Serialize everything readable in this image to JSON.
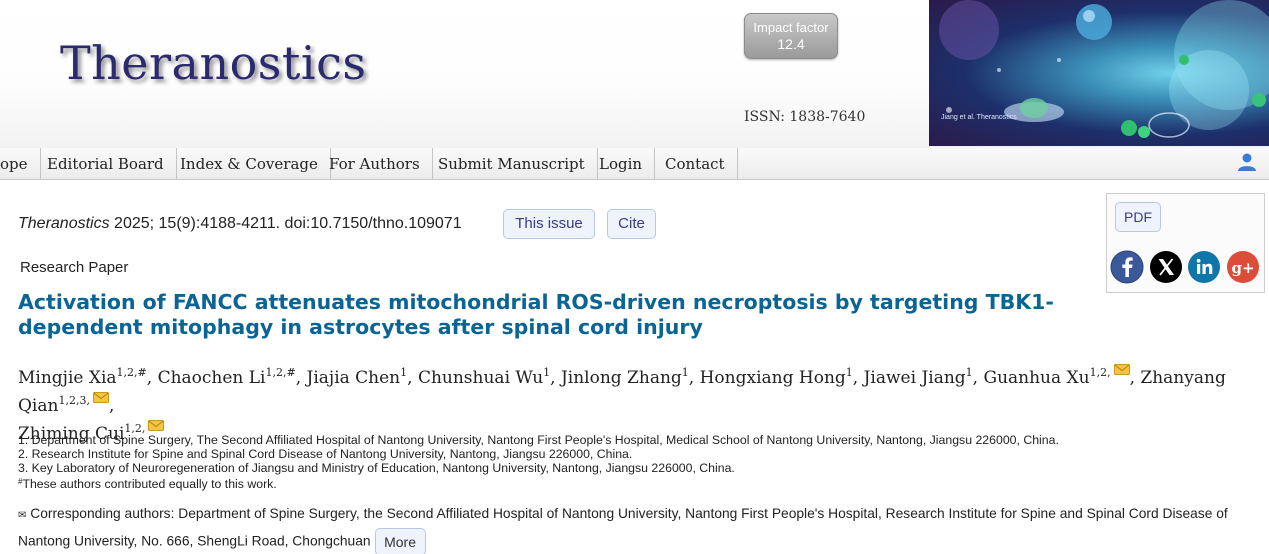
{
  "header": {
    "logo": "Theranostics",
    "impact_factor": {
      "label": "Impact factor",
      "value": "12.4"
    },
    "issn": "ISSN: 1838-7640",
    "cover_credit": "Jiang et al. Theranostics"
  },
  "nav": {
    "items": [
      "ope",
      "Editorial Board",
      "Index & Coverage",
      "For Authors",
      "Submit Manuscript",
      "Login",
      "Contact"
    ]
  },
  "citation": {
    "journal": "Theranostics",
    "details": " 2025; 15(9):4188-4211. doi:10.7150/thno.109071",
    "this_issue": "This issue",
    "cite": "Cite"
  },
  "sidebar": {
    "pdf": "PDF",
    "social": [
      "facebook",
      "x",
      "linkedin",
      "google-plus"
    ]
  },
  "article": {
    "type": "Research Paper",
    "title_line1": "Activation of FANCC attenuates mitochondrial ROS-driven necroptosis by targeting TBK1-",
    "title_line2": "dependent mitophagy in astrocytes after spinal cord injury",
    "authors": [
      {
        "name": "Mingjie Xia",
        "sup": "1,2,#",
        "corresponding": false
      },
      {
        "name": "Chaochen Li",
        "sup": "1,2,#",
        "corresponding": false
      },
      {
        "name": "Jiajia Chen",
        "sup": "1",
        "corresponding": false
      },
      {
        "name": "Chunshuai Wu",
        "sup": "1",
        "corresponding": false
      },
      {
        "name": "Jinlong Zhang",
        "sup": "1",
        "corresponding": false
      },
      {
        "name": "Hongxiang Hong",
        "sup": "1",
        "corresponding": false
      },
      {
        "name": "Jiawei Jiang",
        "sup": "1",
        "corresponding": false
      },
      {
        "name": "Guanhua Xu",
        "sup": "1,2,",
        "corresponding": true
      },
      {
        "name": "Zhanyang Qian",
        "sup": "1,2,3,",
        "corresponding": true
      },
      {
        "name": "Zhiming Cui",
        "sup": "1,2,",
        "corresponding": true
      }
    ],
    "affiliations": [
      "1. Department of Spine Surgery, The Second Affiliated Hospital of Nantong University, Nantong First People's Hospital, Medical School of Nantong University, Nantong, Jiangsu 226000, China.",
      "2. Research Institute for Spine and Spinal Cord Disease of Nantong University, Nantong, Jiangsu 226000, China.",
      "3. Key Laboratory of Neuroregeneration of Jiangsu and Ministry of Education, Nantong University, Nantong, Jiangsu 226000, China."
    ],
    "equal_contrib_mark": "#",
    "equal_contrib": "These authors contributed equally to this work.",
    "corresponding_icon": "✉",
    "corresponding_text": " Corresponding authors: Department of Spine Surgery, the Second Affiliated Hospital of Nantong University, Nantong First People's Hospital, Research Institute for Spine and Spinal Cord Disease of Nantong University, No. 666, ShengLi Road, Chongchuan",
    "more": "More"
  },
  "colors": {
    "title": "#0a6494",
    "logo": "#2c2a6e",
    "button_bg": "#eef3fc",
    "button_border": "#b7c7e8"
  }
}
